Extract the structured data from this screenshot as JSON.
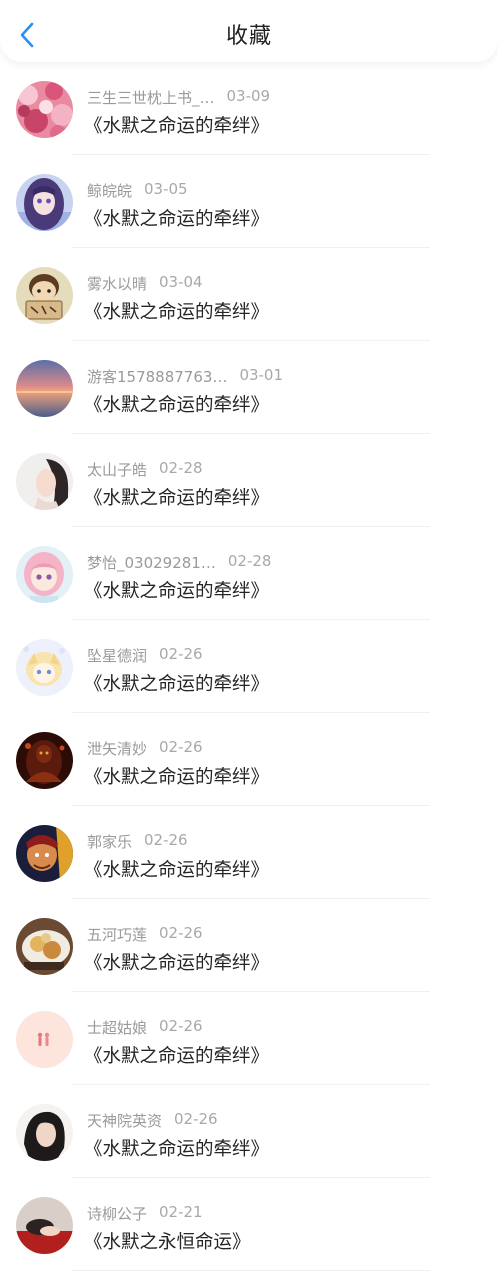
{
  "header": {
    "title": "收藏",
    "back_icon": "chevron-left-icon",
    "accent_color": "#2b8ef0"
  },
  "items": [
    {
      "name": "三生三世枕上书_…",
      "date": "03-09",
      "text": "《水默之命运的牵绊》",
      "avatar": "pink-blossom-photo",
      "name_width": 150
    },
    {
      "name": "鲸皖皖",
      "date": "03-05",
      "text": "《水默之命运的牵绊》",
      "avatar": "anime-purple-hair"
    },
    {
      "name": "雾水以晴",
      "date": "03-04",
      "text": "《水默之命运的牵绊》",
      "avatar": "cartoon-boy-sign"
    },
    {
      "name": "游客1578887763…",
      "date": "03-01",
      "text": "《水默之命运的牵绊》",
      "avatar": "sunset-sea-photo"
    },
    {
      "name": "太山子皓",
      "date": "02-28",
      "text": "《水默之命运的牵绊》",
      "avatar": "girl-portrait-white"
    },
    {
      "name": "梦怡_03029281…",
      "date": "02-28",
      "text": "《水默之命运的牵绊》",
      "avatar": "anime-pink-hair"
    },
    {
      "name": "坠星德润",
      "date": "02-26",
      "text": "《水默之命运的牵绊》",
      "avatar": "anime-blonde-chibi"
    },
    {
      "name": "泄矢清妙",
      "date": "02-26",
      "text": "《水默之命运的牵绊》",
      "avatar": "dark-warrior"
    },
    {
      "name": "郭家乐",
      "date": "02-26",
      "text": "《水默之命运的牵绊》",
      "avatar": "game-hero"
    },
    {
      "name": "五河巧莲",
      "date": "02-26",
      "text": "《水默之命运的牵绊》",
      "avatar": "food-photo"
    },
    {
      "name": "士超姑娘",
      "date": "02-26",
      "text": "《水默之命运的牵绊》",
      "avatar": "pink-couple-illustration"
    },
    {
      "name": "天神院英资",
      "date": "02-26",
      "text": "《水默之命运的牵绊》",
      "avatar": "dark-hair-girl"
    },
    {
      "name": "诗柳公子",
      "date": "02-21",
      "text": "《水默之永恒命运》",
      "avatar": "red-scene-photo"
    }
  ]
}
